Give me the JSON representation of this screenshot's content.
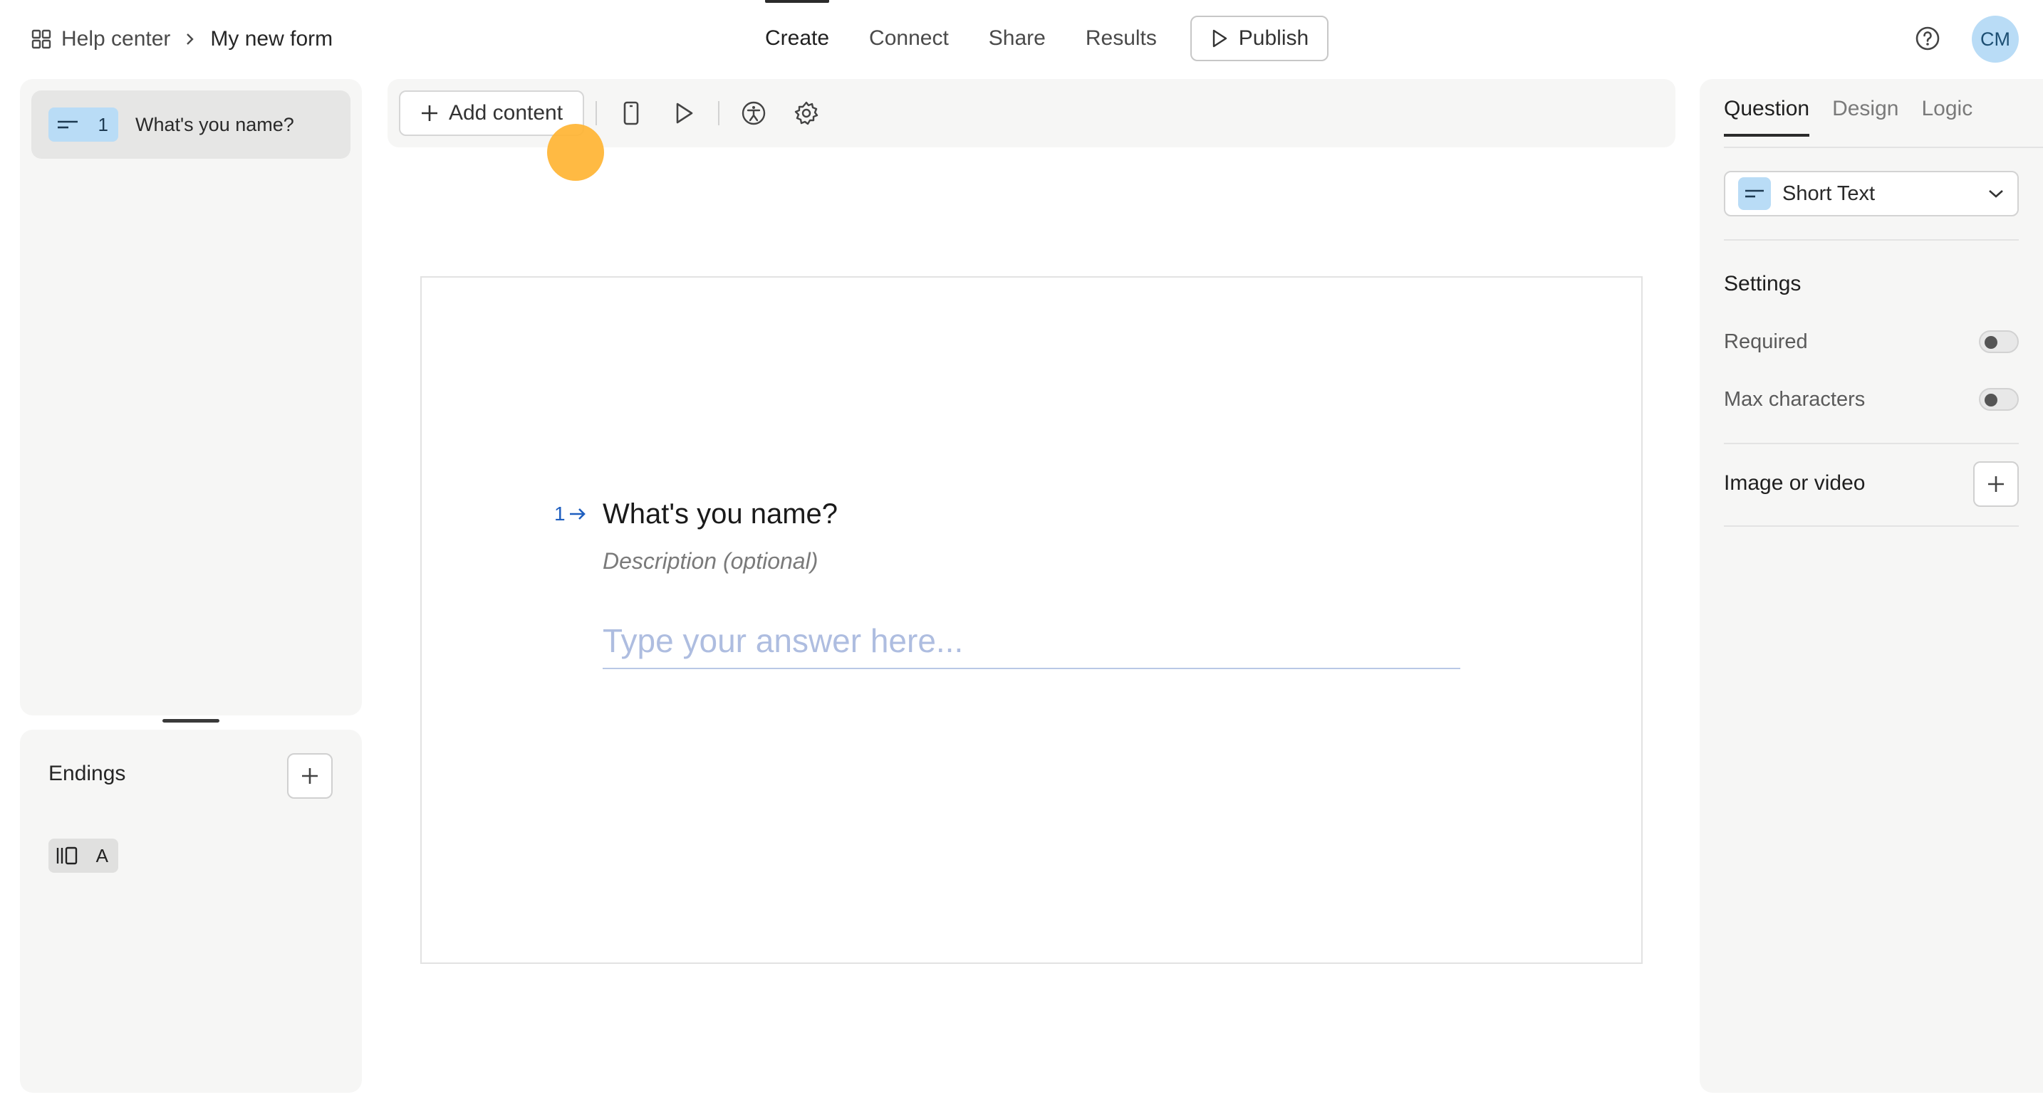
{
  "breadcrumb": {
    "home": "Help center",
    "current": "My new form"
  },
  "topnav": {
    "tabs": [
      "Create",
      "Connect",
      "Share",
      "Results"
    ],
    "active": "Create",
    "publish": "Publish"
  },
  "user": {
    "initials": "CM"
  },
  "questions_list": [
    {
      "number": "1",
      "label": "What's you name?",
      "icon": "short-text-icon"
    }
  ],
  "endings": {
    "title": "Endings",
    "items": [
      {
        "label": "A",
        "icon": "ending-icon"
      }
    ]
  },
  "toolbar": {
    "add_content": "Add content",
    "icons": [
      "mobile-preview-icon",
      "play-icon",
      "accessibility-icon",
      "settings-gear-icon"
    ]
  },
  "canvas": {
    "number": "1",
    "title": "What's you name?",
    "description": "Description (optional)",
    "answer_placeholder": "Type your answer here..."
  },
  "right_panel": {
    "tabs": [
      "Question",
      "Design",
      "Logic"
    ],
    "active_tab": "Question",
    "question_type": "Short Text",
    "settings_title": "Settings",
    "settings": [
      {
        "label": "Required",
        "enabled": false
      },
      {
        "label": "Max characters",
        "enabled": false
      }
    ],
    "media_label": "Image or video"
  },
  "colors": {
    "accent_blue": "#b9dcf6",
    "cursor": "#ffb433",
    "question_number": "#1f5fbf"
  }
}
